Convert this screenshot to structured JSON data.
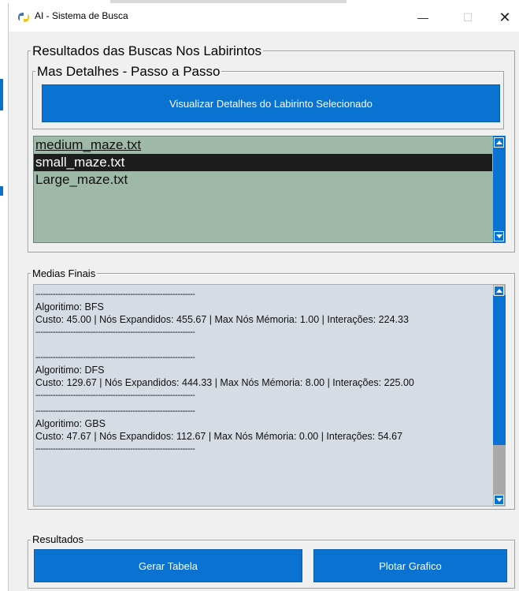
{
  "window": {
    "title": "AI - Sistema de Busca",
    "minimize_label": "—",
    "maximize_label": "☐",
    "close_label": "✕"
  },
  "results_frame": {
    "label": "Resultados das Buscas Nos Labirintos",
    "details_label": "Mas Detalhes - Passo a Passo",
    "view_button": "Visualizar Detalhes do Labirinto Selecionado"
  },
  "maze_list": {
    "items": [
      "medium_maze.txt",
      "small_maze.txt",
      "Large_maze.txt"
    ],
    "selected": "small_maze.txt"
  },
  "averages": {
    "label": "Medias Finais",
    "separator": "----------------------------------------------------------------",
    "entries": [
      {
        "algorithm": "Algoritimo: BFS",
        "stats": "Custo: 45.00 | Nós Expandidos: 455.67 | Max Nós Mémoria: 1.00 | Interações: 224.33"
      },
      {
        "algorithm": "Algoritimo: DFS",
        "stats": "Custo: 129.67 | Nós Expandidos: 444.33 | Max Nós Mémoria: 8.00 | Interações: 225.00"
      },
      {
        "algorithm": "Algoritimo: GBS",
        "stats": "Custo: 47.67 | Nós Expandidos: 112.67 | Max Nós Mémoria: 0.00 | Interações: 54.67"
      }
    ]
  },
  "results": {
    "label": "Resultados",
    "table_button": "Gerar Tabela",
    "plot_button": "Plotar Grafico"
  },
  "colors": {
    "accent": "#0a72d0",
    "listbox_bg": "#9eb9a8",
    "textbox_bg": "#d6dce4",
    "selection": "#1d1d1d"
  }
}
